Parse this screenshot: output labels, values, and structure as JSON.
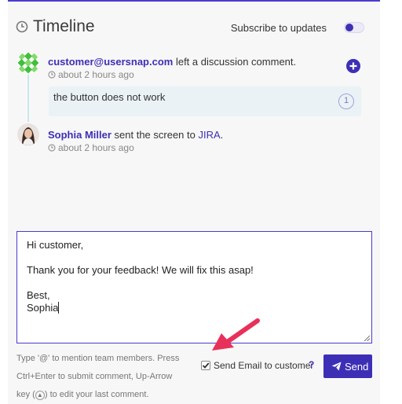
{
  "header": {
    "title": "Timeline",
    "subscribe_label": "Subscribe to updates"
  },
  "timeline": {
    "entries": [
      {
        "author": "customer@usersnap.com",
        "action": " left a discussion comment.",
        "time": "about 2 hours ago",
        "comment": "the button does not work",
        "comment_count": "1"
      },
      {
        "author": "Sophia Miller",
        "action": " sent the screen to ",
        "target": "JIRA",
        "suffix": ".",
        "time": "about 2 hours ago"
      }
    ]
  },
  "composer": {
    "lines": [
      "Hi customer,",
      "",
      "Thank you for your feedback! We will fix this asap!",
      "",
      "Best,",
      "Sophia"
    ],
    "hint_line1": "Type '@' to mention team members. Press",
    "hint_line2": "Ctrl+Enter to submit comment, Up-Arrow",
    "hint_line3_pre": "key (",
    "hint_line3_post": ") to edit your last comment.",
    "send_email_label": "Send Email to customer",
    "help_mark": "?",
    "send_label": "Send"
  },
  "colors": {
    "accent": "#3d2fb5",
    "annotation_arrow": "#e8315a",
    "timeline_line": "#c8e8ee",
    "bubble": "#eaf2f6"
  },
  "icons": [
    "clock-icon",
    "plus-circle-icon",
    "paper-plane-icon",
    "checkmark-icon",
    "up-arrow-key-icon"
  ]
}
